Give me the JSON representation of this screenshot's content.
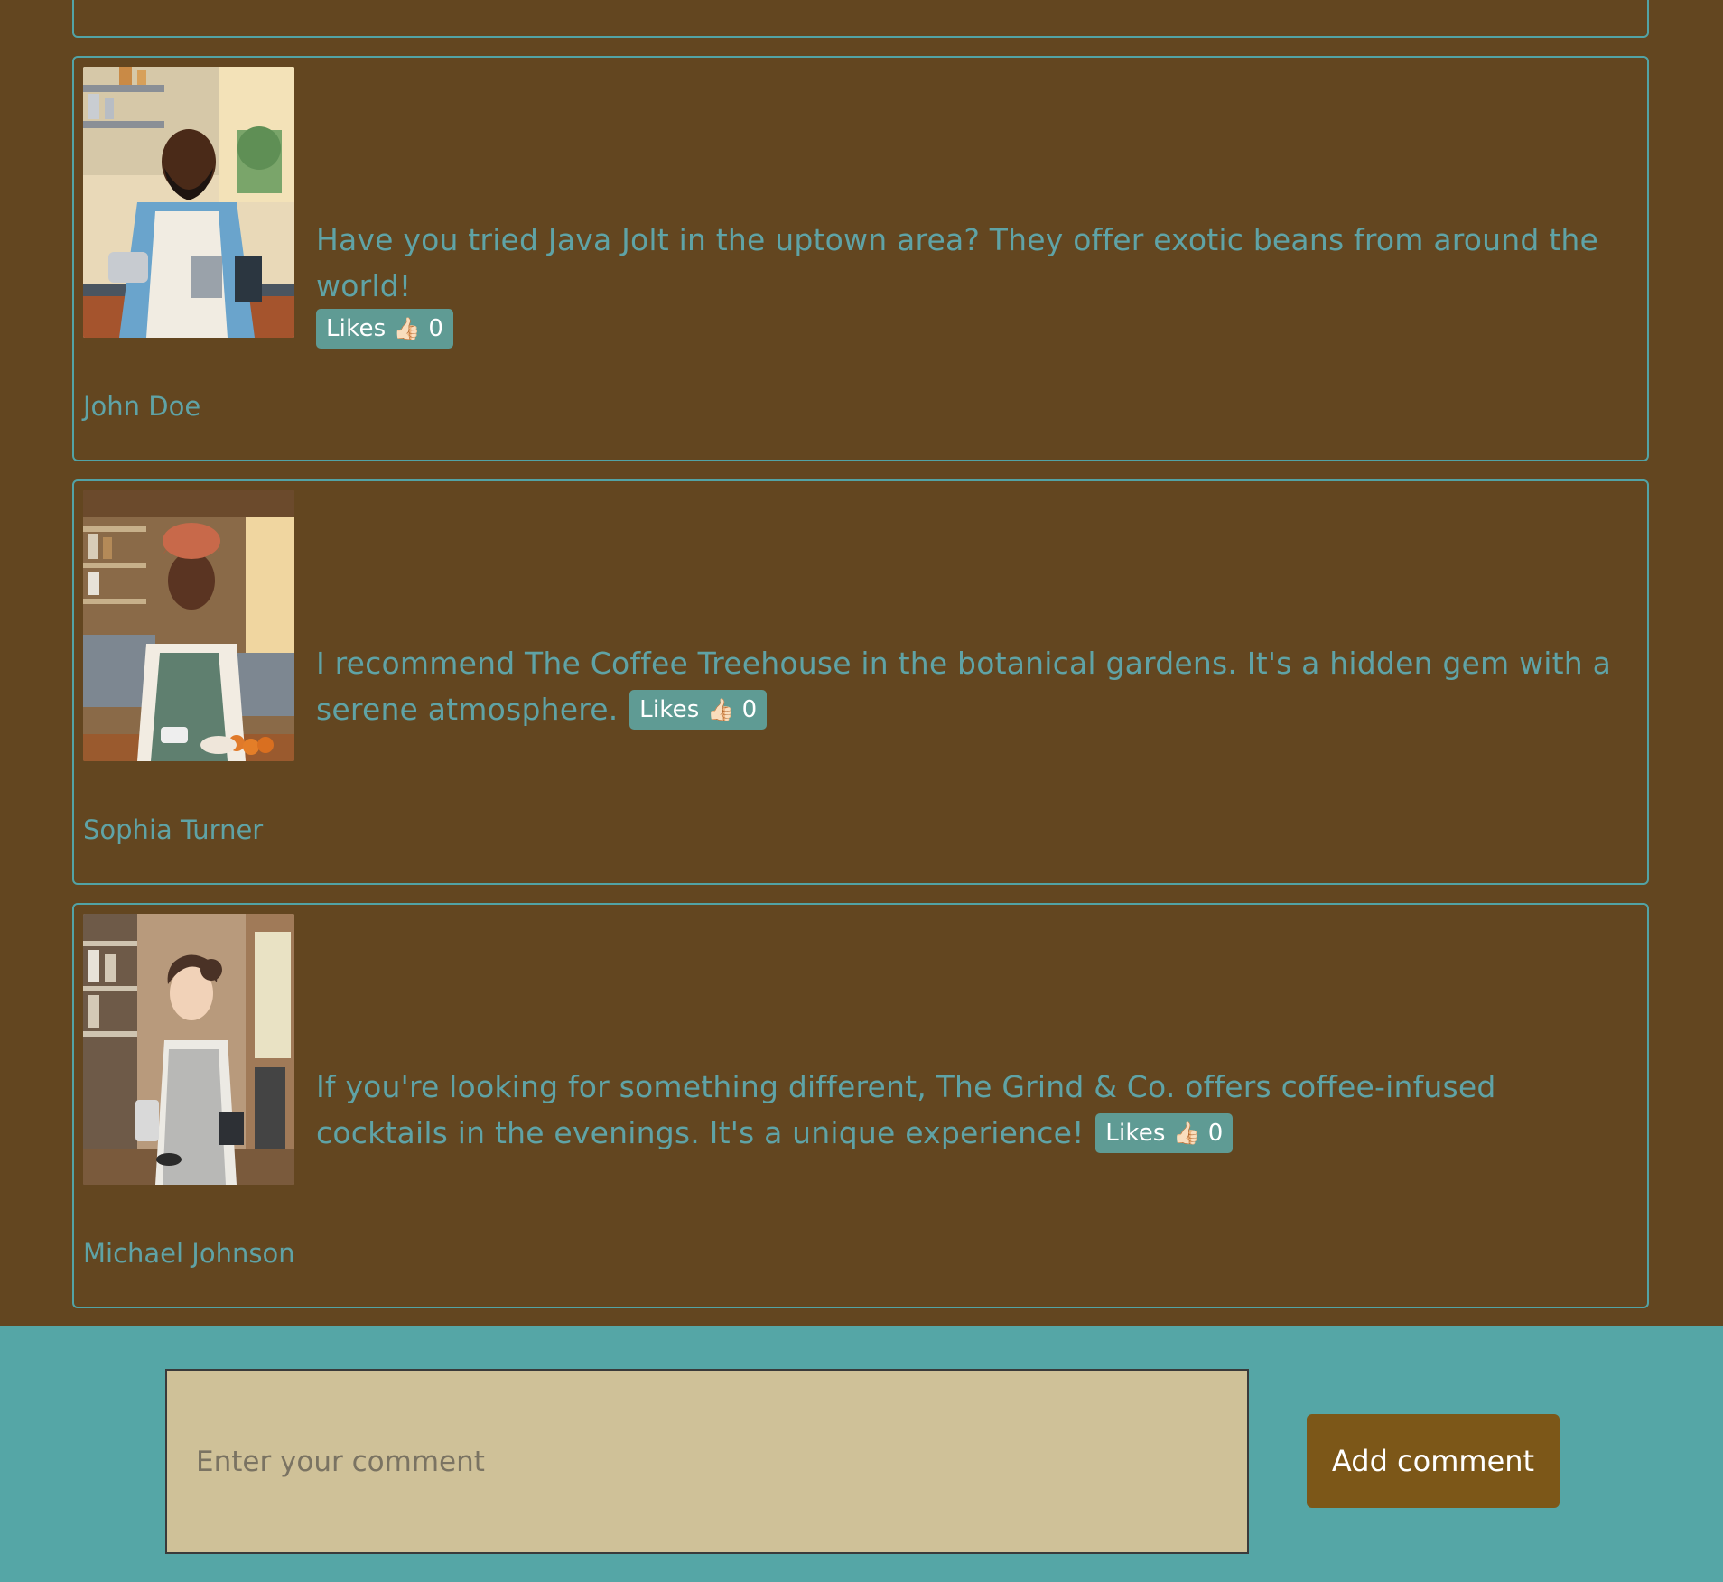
{
  "comments": [
    {
      "author": "John Doe",
      "text": "Have you tried Java Jolt in the uptown area? They offer exotic beans from around the world!",
      "likes_label": "Likes",
      "likes_icon": "👍🏻",
      "likes_count": "0",
      "avatar": "barista-man-portrait"
    },
    {
      "author": "Sophia Turner",
      "text": "I recommend The Coffee Treehouse in the botanical gardens. It's a hidden gem with a serene atmosphere.",
      "likes_label": "Likes",
      "likes_icon": "👍🏻",
      "likes_count": "0",
      "avatar": "barista-woman-headwrap-portrait"
    },
    {
      "author": "Michael Johnson",
      "text": "If you're looking for something different, The Grind & Co. offers coffee-infused cocktails in the evenings. It's a unique experience!",
      "likes_label": "Likes",
      "likes_icon": "👍🏻",
      "likes_count": "0",
      "avatar": "barista-woman-apron-portrait"
    }
  ],
  "form": {
    "placeholder": "Enter your comment",
    "submit_label": "Add comment"
  },
  "colors": {
    "background": "#634620",
    "accent": "#52a3a5",
    "footer": "#55a6a6",
    "input_bg": "#cfc198",
    "button_bg": "#7c5718",
    "likes_bg": "#5f9b94"
  }
}
